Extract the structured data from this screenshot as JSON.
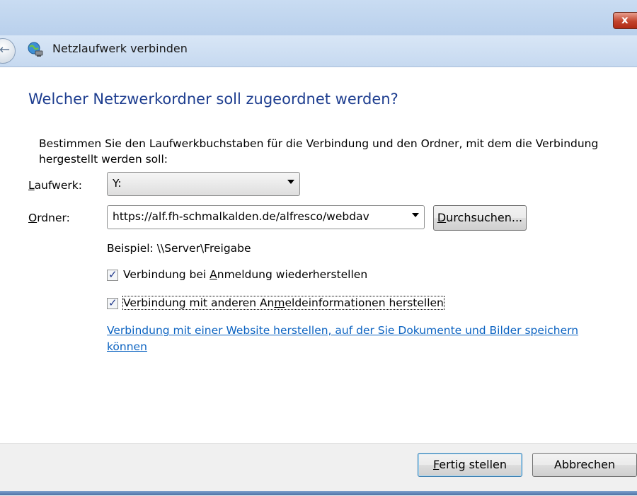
{
  "window": {
    "title": "Netzlaufwerk verbinden",
    "close_glyph": "x"
  },
  "nav": {
    "back_icon": "back-arrow-icon",
    "app_icon": "network-drive-icon"
  },
  "heading": "Welcher Netzwerkordner soll zugeordnet werden?",
  "description": "Bestimmen Sie den Laufwerkbuchstaben für die Verbindung und den Ordner, mit dem die Verbindung hergestellt werden soll:",
  "drive": {
    "label": "Laufwerk:",
    "value": "Y:"
  },
  "folder": {
    "label": "Ordner:",
    "value": "https://alf.fh-schmalkalden.de/alfresco/webdav",
    "browse_label": "Durchsuchen..."
  },
  "example": "Beispiel: \\\\Server\\Freigabe",
  "options": [
    {
      "label": "Verbindung bei Anmeldung wiederherstellen",
      "checked": true
    },
    {
      "label": "Verbindung mit anderen Anmeldeinformationen herstellen",
      "checked": true
    }
  ],
  "website_link": "Verbindung mit einer Website herstellen, auf der Sie Dokumente und Bilder speichern können",
  "footer": {
    "finish_label": "Fertig stellen",
    "cancel_label": "Abbrechen"
  },
  "colors": {
    "heading": "#1d3d8f",
    "link": "#0a62c1",
    "titlebar": "#c9dcf2"
  }
}
